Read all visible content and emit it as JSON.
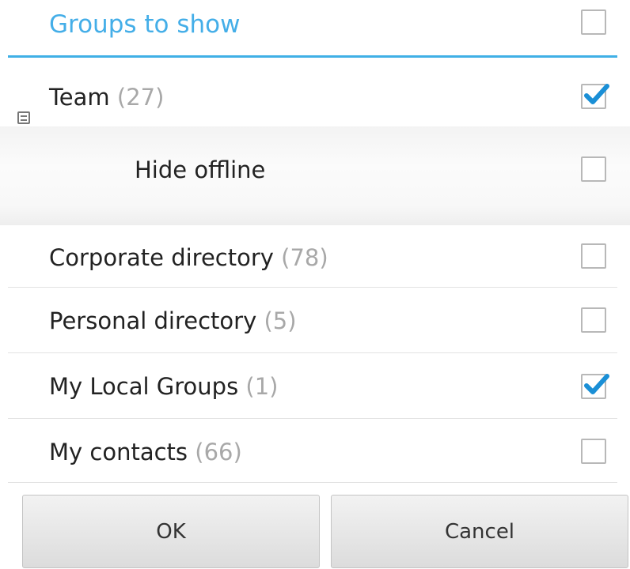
{
  "dialog": {
    "title": "Groups to show",
    "select_all_checked": false
  },
  "groups": [
    {
      "name": "Team",
      "count": "(27)",
      "checked": true
    },
    {
      "name": "Corporate directory",
      "count": "(78)",
      "checked": false
    },
    {
      "name": "Personal directory",
      "count": "(5)",
      "checked": false
    },
    {
      "name": "My Local Groups",
      "count": "(1)",
      "checked": true
    },
    {
      "name": "My contacts",
      "count": "(66)",
      "checked": false
    }
  ],
  "team_options": {
    "hide_offline_label": "Hide offline",
    "hide_offline_checked": false
  },
  "buttons": {
    "ok_label": "OK",
    "cancel_label": "Cancel"
  },
  "colors": {
    "title": "#44aee8",
    "accent_line": "#3fb0e6",
    "check": "#1a8fd6",
    "count_text": "#a8a8a8"
  }
}
